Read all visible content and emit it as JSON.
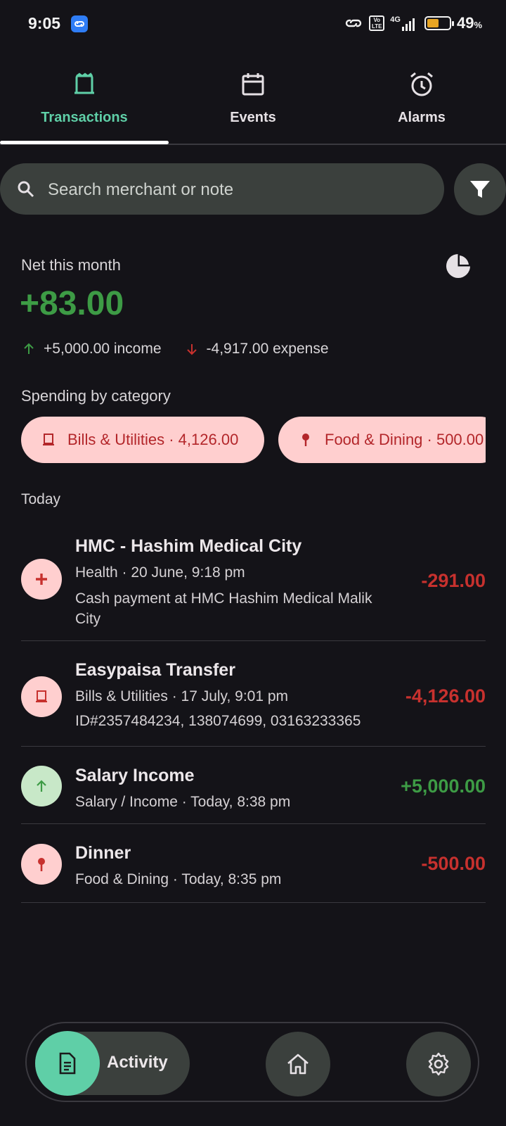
{
  "status_bar": {
    "time": "9:05",
    "battery": "49",
    "battery_unit": "%",
    "network": "4G",
    "volte": "Vo LTE"
  },
  "tabs": [
    {
      "label": "Transactions",
      "icon": "receipt-icon",
      "active": true
    },
    {
      "label": "Events",
      "icon": "calendar-icon",
      "active": false
    },
    {
      "label": "Alarms",
      "icon": "alarm-clock-icon",
      "active": false
    }
  ],
  "search": {
    "placeholder": "Search merchant or note",
    "value": ""
  },
  "summary": {
    "net_label": "Net this month",
    "net_value": "+83.00",
    "income": "+5,000.00 income",
    "expense": "-4,917.00 expense"
  },
  "spending": {
    "label": "Spending by category",
    "chips": [
      {
        "label": "Bills & Utilities · 4,126.00",
        "icon": "receipt-icon"
      },
      {
        "label": "Food & Dining · 500.00",
        "icon": "pin-icon"
      }
    ]
  },
  "section_today": "Today",
  "transactions": [
    {
      "name": "HMC - Hashim Medical City",
      "meta": "Health · 20 June, 9:18 pm",
      "note": "Cash payment at HMC Hashim Medical Malik City",
      "amount": "-291.00",
      "icon": "plus-icon"
    },
    {
      "name": "Easypaisa Transfer",
      "meta": "Bills & Utilities · 17 July, 9:01 pm",
      "note": "ID#2357484234, 138074699, 03163233365",
      "amount": "-4,126.00",
      "icon": "receipt-icon"
    },
    {
      "name": "Salary Income",
      "meta": "Salary / Income · Today, 8:38 pm",
      "amount": "+5,000.00",
      "icon": "arrow-up-icon"
    },
    {
      "name": "Dinner",
      "meta": "Food & Dining · Today, 8:35 pm",
      "amount": "-500.00",
      "icon": "pin-icon"
    }
  ],
  "bottom_nav": {
    "activity_label": "Activity"
  },
  "colors": {
    "accent": "#5fcfa7",
    "positive": "#3d9b45",
    "negative": "#c7312e",
    "chip_bg": "#ffcfcf"
  }
}
